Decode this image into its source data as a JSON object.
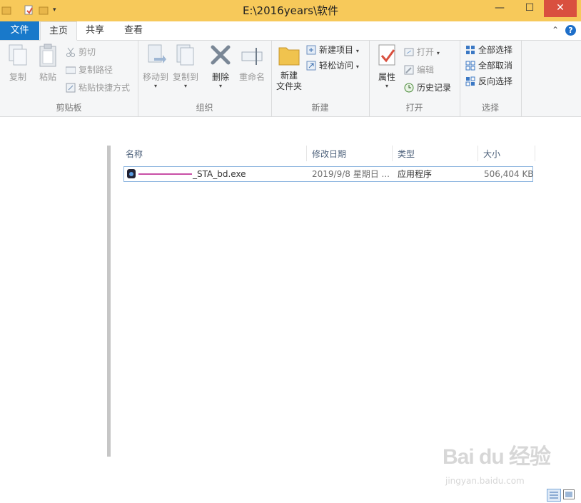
{
  "window": {
    "title": "E:\\2016years\\软件",
    "minimize_glyph": "—",
    "maximize_glyph": "☐",
    "close_glyph": "✕"
  },
  "tabs": {
    "file": "文件",
    "home": "主页",
    "share": "共享",
    "view": "查看",
    "collapse_glyph": "⌃",
    "help_glyph": "?"
  },
  "ribbon": {
    "clipboard": {
      "label": "剪贴板",
      "copy": "复制",
      "paste": "粘贴",
      "cut": "剪切",
      "copy_path": "复制路径",
      "paste_shortcut": "粘贴快捷方式"
    },
    "organize": {
      "label": "组织",
      "move_to": "移动到",
      "copy_to": "复制到",
      "delete": "删除",
      "rename": "重命名"
    },
    "new": {
      "label": "新建",
      "new_folder_line1": "新建",
      "new_folder_line2": "文件夹",
      "new_item": "新建项目",
      "easy_access": "轻松访问"
    },
    "open": {
      "label": "打开",
      "properties": "属性",
      "open": "打开",
      "edit": "编辑",
      "history": "历史记录"
    },
    "select": {
      "label": "选择",
      "select_all": "全部选择",
      "select_none": "全部取消",
      "invert": "反向选择"
    }
  },
  "file_list": {
    "columns": [
      "名称",
      "修改日期",
      "类型",
      "大小"
    ],
    "rows": [
      {
        "name": "_STA_bd.exe",
        "modified": "2019/9/8 星期日 ...",
        "type": "应用程序",
        "size": "506,404 KB"
      }
    ]
  },
  "watermark": {
    "main": "Bai du 经验",
    "sub": "jingyan.baidu.com"
  },
  "colors": {
    "titlebar": "#f7c95a",
    "file_tab": "#1979ca",
    "close_button": "#d9503f",
    "selection_border": "#89b3de"
  }
}
